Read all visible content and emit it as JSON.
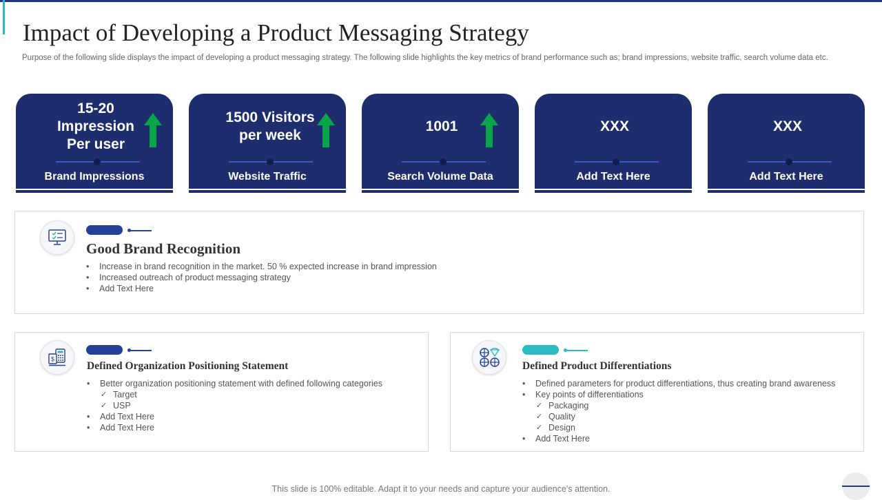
{
  "page": {
    "title": "Impact of Developing a Product Messaging Strategy",
    "subtitle": "Purpose of the following slide displays the impact of developing a product messaging strategy. The following slide highlights the key metrics of brand performance such as; brand impressions, website traffic, search volume data etc."
  },
  "colors": {
    "navy": "#1d2d6e",
    "arrow_green": "#0ba44a",
    "teal": "#2bb9c2",
    "blue": "#23409a"
  },
  "kpis": [
    {
      "value": "15-20\nImpression\nPer user",
      "label": "Brand Impressions",
      "arrow": "up-arrow-icon"
    },
    {
      "value": "1500 Visitors\nper week",
      "label": "Website Traffic",
      "arrow": "up-arrow-icon"
    },
    {
      "value": "1001",
      "label": "Search Volume Data",
      "arrow": "up-arrow-icon"
    },
    {
      "value": "XXX",
      "label": "Add Text Here"
    },
    {
      "value": "XXX",
      "label": "Add Text Here"
    }
  ],
  "sections": {
    "brand": {
      "title": "Good Brand Recognition",
      "icon": "monitor-checklist-icon",
      "points": [
        "Increase in brand recognition in the market. 50 % expected increase in brand impression",
        "Increased outreach of product messaging strategy",
        "Add Text Here"
      ]
    },
    "positioning": {
      "title": "Defined Organization Positioning Statement",
      "icon": "calculator-money-icon",
      "points": [
        "Better organization positioning statement with defined following categories",
        "Target",
        "USP",
        "Add Text Here",
        "Add Text Here"
      ]
    },
    "differentiation": {
      "title": "Defined Product Differentiations",
      "icon": "product-grid-icon",
      "points": [
        "Defined parameters for product differentiations, thus creating brand awareness",
        "Key points of differentiations",
        "Packaging",
        "Quality",
        "Design",
        "Add Text Here"
      ]
    }
  },
  "footer": "This slide is 100% editable. Adapt it to your needs and capture your audience's attention."
}
